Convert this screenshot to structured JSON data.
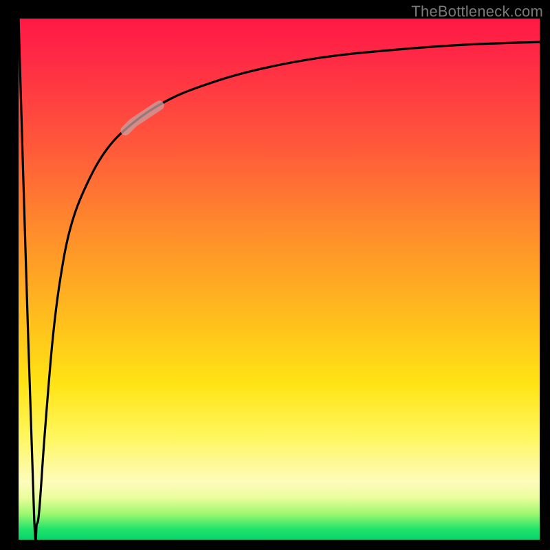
{
  "attribution": "TheBottleneck.com",
  "chart_data": {
    "type": "line",
    "title": "",
    "xlabel": "",
    "ylabel": "",
    "xlim": [
      0,
      100
    ],
    "ylim": [
      0,
      100
    ],
    "grid": false,
    "legend": false,
    "series": [
      {
        "name": "bottleneck-curve",
        "x": [
          0.0,
          1.5,
          3.0,
          3.5,
          4.0,
          5.0,
          6.5,
          8.0,
          10.0,
          13.0,
          17.0,
          22.0,
          28.0,
          35.0,
          45.0,
          58.0,
          72.0,
          86.0,
          100.0
        ],
        "values": [
          100,
          50,
          4,
          3,
          6,
          20,
          38,
          50,
          60,
          68,
          75,
          80,
          84,
          87,
          90,
          92.5,
          94,
          95,
          95.5
        ]
      }
    ],
    "highlight_segment": {
      "series": "bottleneck-curve",
      "x_range": [
        20.5,
        27.0
      ],
      "note": "pale overlay on curve"
    },
    "colors": {
      "curve": "#000000",
      "highlight": "rgba(200,160,160,0.75)",
      "gradient_top": "#ff1845",
      "gradient_bottom": "#08d36a",
      "frame": "#000000",
      "attribution_text": "#7a7a7a"
    }
  }
}
